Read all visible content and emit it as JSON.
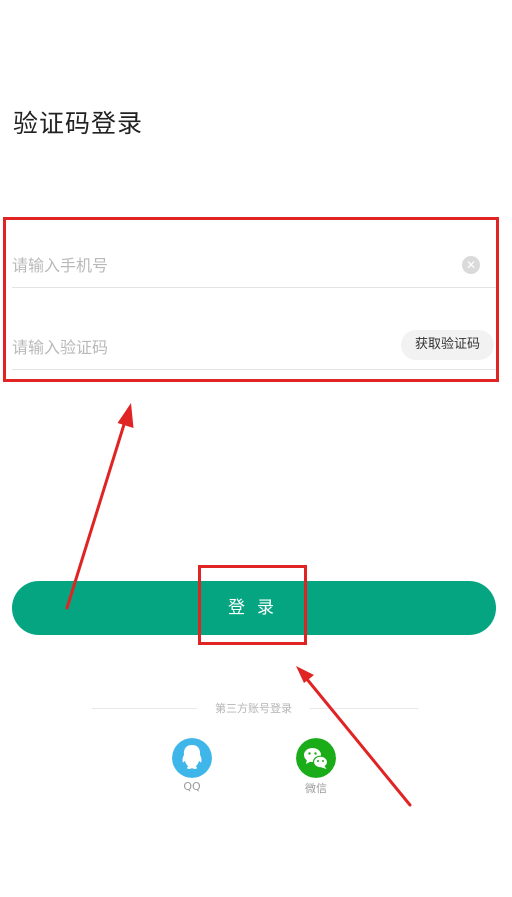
{
  "page": {
    "title": "验证码登录"
  },
  "form": {
    "phone_placeholder": "请输入手机号",
    "code_placeholder": "请输入验证码",
    "get_code_label": "获取验证码",
    "clear_icon": "clear-circle-icon"
  },
  "actions": {
    "login_label": "登录"
  },
  "third_party": {
    "divider_text": "第三方账号登录",
    "providers": [
      {
        "label": "QQ",
        "icon": "qq-icon",
        "color": "#3fb6ea"
      },
      {
        "label": "微信",
        "icon": "wechat-icon",
        "color": "#1aad19"
      }
    ]
  },
  "colors": {
    "primary": "#05a582",
    "annotation": "#e02424"
  }
}
